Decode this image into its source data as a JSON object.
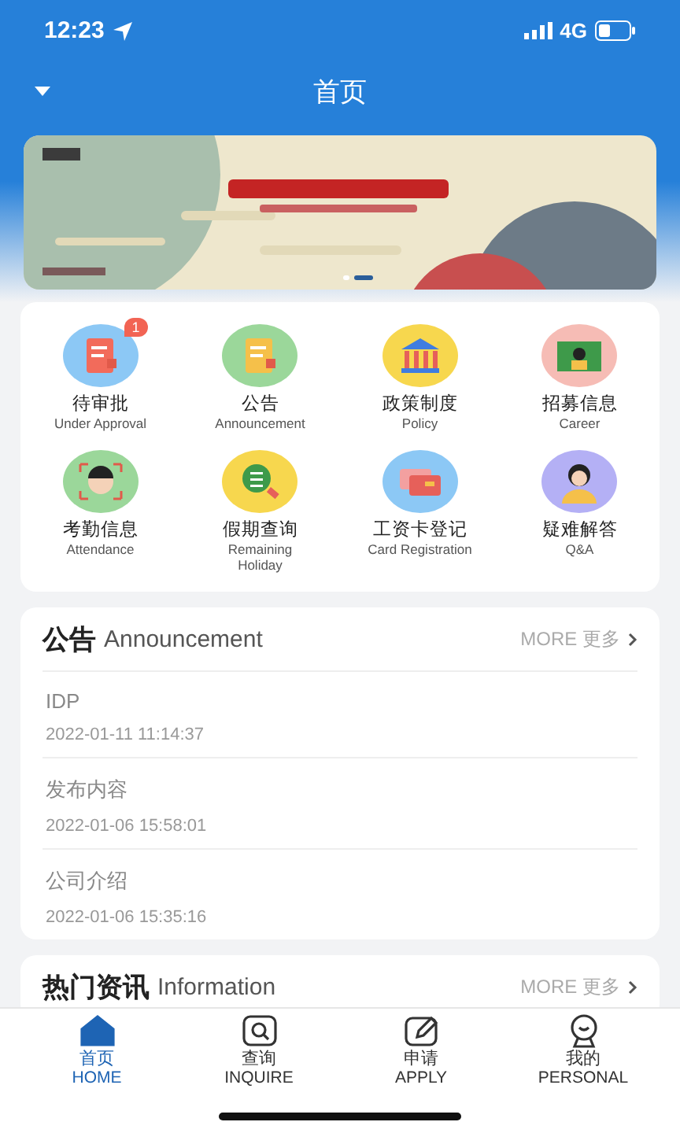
{
  "status_bar": {
    "time": "12:23",
    "network": "4G"
  },
  "nav": {
    "title": "首页"
  },
  "banner": {
    "dots": [
      {
        "selected": false
      },
      {
        "selected": true
      }
    ]
  },
  "shortcuts": [
    {
      "label": "待审批",
      "sublabel": "Under Approval",
      "badge": "1"
    },
    {
      "label": "公告",
      "sublabel": "Announcement"
    },
    {
      "label": "政策制度",
      "sublabel": "Policy"
    },
    {
      "label": "招募信息",
      "sublabel": "Career"
    },
    {
      "label": "考勤信息",
      "sublabel": "Attendance"
    },
    {
      "label": "假期查询",
      "sublabel": "Remaining Holiday"
    },
    {
      "label": "工资卡登记",
      "sublabel": "Card Registration"
    },
    {
      "label": "疑难解答",
      "sublabel": "Q&A"
    }
  ],
  "sections": [
    {
      "title": "公告",
      "subtitle": "Announcement",
      "more": "MORE 更多",
      "items": [
        {
          "title": "IDP",
          "time": "2022-01-11 11:14:37"
        },
        {
          "title": "发布内容",
          "time": "2022-01-06 15:58:01"
        },
        {
          "title": "公司介绍",
          "time": "2022-01-06 15:35:16"
        }
      ]
    },
    {
      "title": "热门资讯",
      "subtitle": "Information",
      "more": "MORE 更多"
    }
  ],
  "tab_bar": [
    {
      "label": "首页",
      "sublabel": "HOME",
      "selected": true
    },
    {
      "label": "查询",
      "sublabel": "INQUIRE",
      "selected": false
    },
    {
      "label": "申请",
      "sublabel": "APPLY",
      "selected": false
    },
    {
      "label": "我的",
      "sublabel": "PERSONAL",
      "selected": false
    }
  ]
}
